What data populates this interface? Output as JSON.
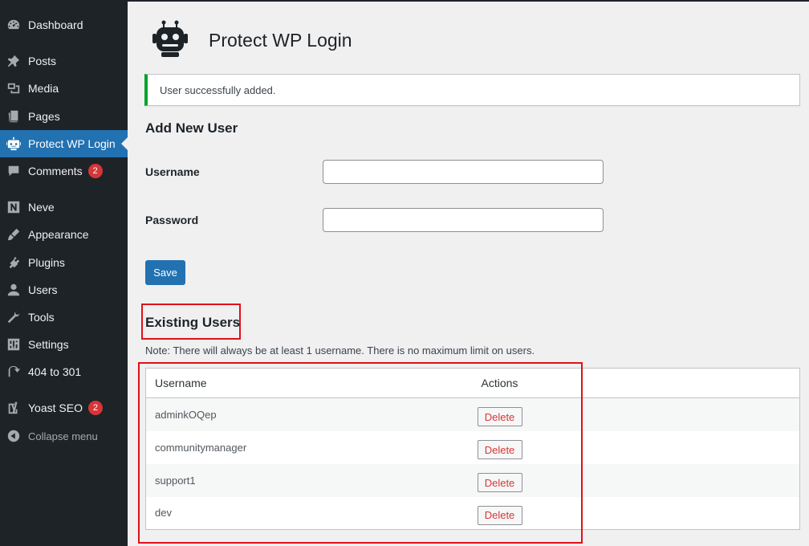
{
  "sidebar": {
    "items": [
      {
        "label": "Dashboard",
        "icon": "dashboard-icon"
      },
      {
        "label": "Posts",
        "icon": "pin-icon"
      },
      {
        "label": "Media",
        "icon": "media-icon"
      },
      {
        "label": "Pages",
        "icon": "pages-icon"
      },
      {
        "label": "Protect WP Login",
        "icon": "robot-icon",
        "active": true
      },
      {
        "label": "Comments",
        "icon": "comment-icon",
        "badge": "2"
      },
      {
        "label": "Neve",
        "icon": "neve-icon"
      },
      {
        "label": "Appearance",
        "icon": "brush-icon"
      },
      {
        "label": "Plugins",
        "icon": "plugin-icon"
      },
      {
        "label": "Users",
        "icon": "user-icon"
      },
      {
        "label": "Tools",
        "icon": "wrench-icon"
      },
      {
        "label": "Settings",
        "icon": "settings-icon"
      },
      {
        "label": "404 to 301",
        "icon": "redirect-icon"
      },
      {
        "label": "Yoast SEO",
        "icon": "yoast-icon",
        "badge": "2"
      }
    ],
    "collapse_label": "Collapse menu"
  },
  "header": {
    "title": "Protect WP Login",
    "logo_icon": "robot-logo-icon"
  },
  "notice": {
    "text": "User successfully added.",
    "color": "#00a32a"
  },
  "add_user": {
    "title": "Add New User",
    "username_label": "Username",
    "username_value": "",
    "password_label": "Password",
    "password_value": "",
    "save_label": "Save"
  },
  "existing_users": {
    "title": "Existing Users",
    "note": "Note: There will always be at least 1 username. There is no maximum limit on users.",
    "columns": [
      "Username",
      "Actions"
    ],
    "rows": [
      {
        "username": "adminkOQep",
        "action": "Delete"
      },
      {
        "username": "communitymanager",
        "action": "Delete"
      },
      {
        "username": "support1",
        "action": "Delete"
      },
      {
        "username": "dev",
        "action": "Delete"
      }
    ]
  },
  "colors": {
    "sidebar_bg": "#1d2327",
    "accent": "#2271b1",
    "highlight": "#e0101a",
    "badge": "#d63638"
  }
}
